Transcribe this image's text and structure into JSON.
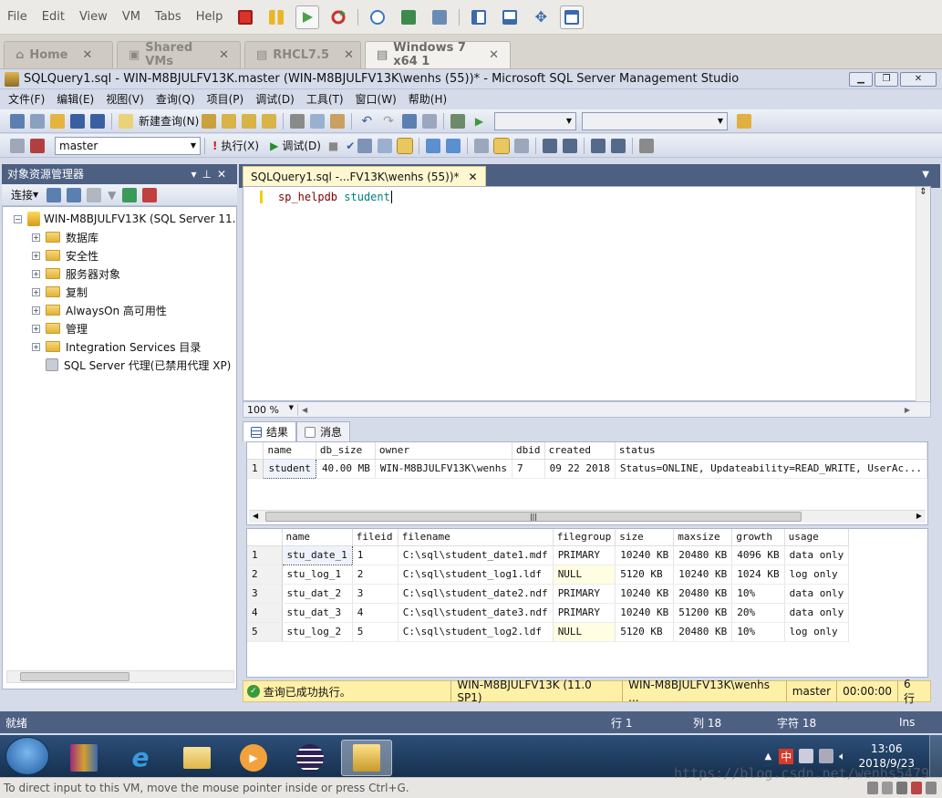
{
  "vm": {
    "menu": [
      "File",
      "Edit",
      "View",
      "VM",
      "Tabs",
      "Help"
    ],
    "tabs": [
      {
        "label": "Home",
        "active": false
      },
      {
        "label": "Shared VMs",
        "active": false
      },
      {
        "label": "RHCL7.5",
        "active": false
      },
      {
        "label": "Windows 7 x64 1",
        "active": true
      }
    ],
    "status_hint": "To direct input to this VM, move the mouse pointer inside or press Ctrl+G."
  },
  "ssms": {
    "window_title": "SQLQuery1.sql - WIN-M8BJULFV13K.master (WIN-M8BJULFV13K\\wenhs (55))* - Microsoft SQL Server Management Studio",
    "menu": [
      "文件(F)",
      "编辑(E)",
      "视图(V)",
      "查询(Q)",
      "项目(P)",
      "调试(D)",
      "工具(T)",
      "窗口(W)",
      "帮助(H)"
    ],
    "toolbar1": {
      "new_query": "新建查询(N)"
    },
    "toolbar2": {
      "database": "master",
      "execute": "执行(X)",
      "debug": "调试(D)"
    },
    "object_explorer": {
      "title": "对象资源管理器",
      "connect": "连接",
      "server": "WIN-M8BJULFV13K (SQL Server 11.",
      "nodes": [
        "数据库",
        "安全性",
        "服务器对象",
        "复制",
        "AlwaysOn 高可用性",
        "管理",
        "Integration Services 目录"
      ],
      "agent": "SQL Server 代理(已禁用代理 XP)"
    },
    "editor": {
      "tab_label": "SQLQuery1.sql -...FV13K\\wenhs (55))*",
      "code_keyword": "sp_helpdb",
      "code_object": "student",
      "zoom": "100 %"
    },
    "results_tabs": {
      "results": "结果",
      "messages": "消息"
    },
    "grid1": {
      "columns": [
        "name",
        "db_size",
        "owner",
        "dbid",
        "created",
        "status"
      ],
      "rows": [
        [
          "1",
          "student",
          "40.00 MB",
          "WIN-M8BJULFV13K\\wenhs",
          "7",
          "09 22 2018",
          "Status=ONLINE, Updateability=READ_WRITE, UserAc..."
        ]
      ]
    },
    "grid2": {
      "columns": [
        "name",
        "fileid",
        "filename",
        "filegroup",
        "size",
        "maxsize",
        "growth",
        "usage"
      ],
      "rows": [
        [
          "1",
          "stu_date_1",
          "1",
          "C:\\sql\\student_date1.mdf",
          "PRIMARY",
          "10240 KB",
          "20480 KB",
          "4096 KB",
          "data only"
        ],
        [
          "2",
          "stu_log_1",
          "2",
          "C:\\sql\\student_log1.ldf",
          "NULL",
          "5120 KB",
          "10240 KB",
          "1024 KB",
          "log only"
        ],
        [
          "3",
          "stu_dat_2",
          "3",
          "C:\\sql\\student_date2.ndf",
          "PRIMARY",
          "10240 KB",
          "20480 KB",
          "10%",
          "data only"
        ],
        [
          "4",
          "stu_dat_3",
          "4",
          "C:\\sql\\student_date3.ndf",
          "PRIMARY",
          "10240 KB",
          "51200 KB",
          "20%",
          "data only"
        ],
        [
          "5",
          "stu_log_2",
          "5",
          "C:\\sql\\student_log2.ldf",
          "NULL",
          "5120 KB",
          "20480 KB",
          "10%",
          "log only"
        ]
      ]
    },
    "query_status": {
      "message": "查询已成功执行。",
      "server": "WIN-M8BJULFV13K (11.0 SP1)",
      "user": "WIN-M8BJULFV13K\\wenhs ...",
      "database": "master",
      "elapsed": "00:00:00",
      "rows": "6 行"
    },
    "app_status": {
      "ready": "就绪",
      "line": "行 1",
      "col": "列 18",
      "char": "字符 18",
      "mode": "Ins"
    }
  },
  "taskbar": {
    "time": "13:06",
    "date": "2018/9/23",
    "ime": "中",
    "watermark": "https://blog.csdn.net/wenhs5479"
  },
  "colors": {
    "accent": "#4d6082",
    "status_yellow": "#fff0a8",
    "keyword": "#800000",
    "object": "#008080"
  }
}
